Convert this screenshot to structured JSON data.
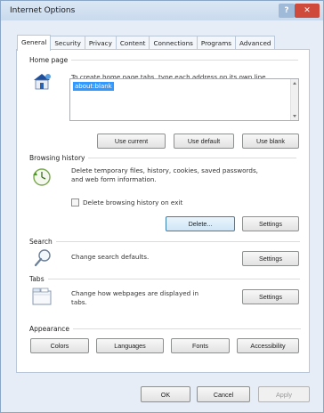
{
  "window": {
    "title": "Internet Options",
    "help_glyph": "?",
    "close_glyph": "✕"
  },
  "tabs": [
    {
      "label": "General",
      "active": true
    },
    {
      "label": "Security"
    },
    {
      "label": "Privacy"
    },
    {
      "label": "Content"
    },
    {
      "label": "Connections"
    },
    {
      "label": "Programs"
    },
    {
      "label": "Advanced"
    }
  ],
  "home_page": {
    "heading": "Home page",
    "icon": "home-page-icon",
    "description": "To create home page tabs, type each address on its own line.",
    "textarea_value": "about:blank",
    "buttons": {
      "use_current": "Use current",
      "use_default": "Use default",
      "use_blank": "Use blank"
    }
  },
  "browsing_history": {
    "heading": "Browsing history",
    "icon": "browsing-history-icon",
    "description_line1": "Delete temporary files, history, cookies, saved passwords,",
    "description_line2": "and web form information.",
    "checkbox_label": "Delete browsing history on exit",
    "checkbox_checked": false,
    "buttons": {
      "delete": "Delete...",
      "settings": "Settings"
    }
  },
  "search": {
    "heading": "Search",
    "icon": "search-icon",
    "description": "Change search defaults.",
    "buttons": {
      "settings": "Settings"
    }
  },
  "tabs_section": {
    "heading": "Tabs",
    "icon": "tabs-icon",
    "description_line1": "Change how webpages are displayed in",
    "description_line2": "tabs.",
    "buttons": {
      "settings": "Settings"
    }
  },
  "appearance": {
    "heading": "Appearance",
    "buttons": {
      "colors": "Colors",
      "languages": "Languages",
      "fonts": "Fonts",
      "accessibility": "Accessibility"
    }
  },
  "dialog_buttons": {
    "ok": "OK",
    "cancel": "Cancel",
    "apply": "Apply"
  },
  "colors": {
    "window_bg": "#e6edf6",
    "selection": "#3399ff",
    "close_button": "#cf4a3b"
  }
}
